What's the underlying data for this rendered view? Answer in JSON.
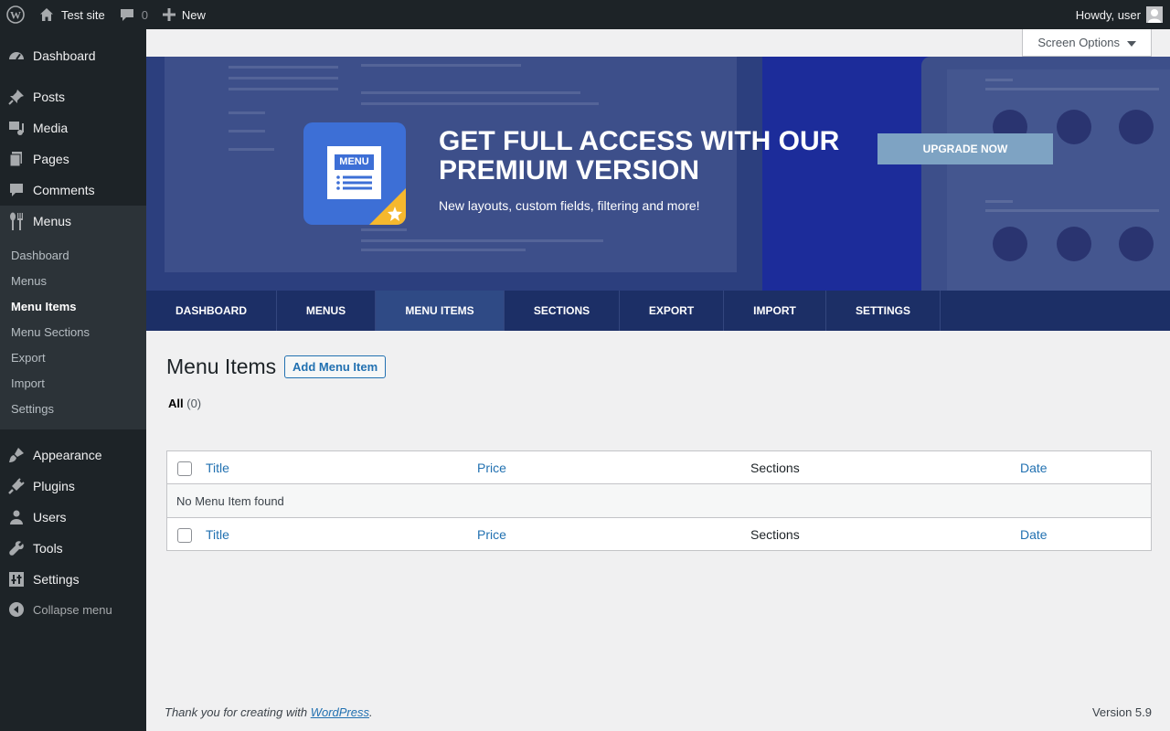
{
  "adminbar": {
    "site_name": "Test site",
    "comments_count": "0",
    "new_label": "New",
    "howdy": "Howdy, user"
  },
  "sidebar": {
    "items": [
      {
        "label": "Dashboard",
        "icon": "dashboard-icon"
      },
      {
        "label": "Posts",
        "icon": "pin-icon"
      },
      {
        "label": "Media",
        "icon": "media-icon"
      },
      {
        "label": "Pages",
        "icon": "pages-icon"
      },
      {
        "label": "Comments",
        "icon": "comment-icon"
      },
      {
        "label": "Menus",
        "icon": "fork-knife-icon"
      },
      {
        "label": "Appearance",
        "icon": "brush-icon"
      },
      {
        "label": "Plugins",
        "icon": "plug-icon"
      },
      {
        "label": "Users",
        "icon": "user-icon"
      },
      {
        "label": "Tools",
        "icon": "wrench-icon"
      },
      {
        "label": "Settings",
        "icon": "settings-icon"
      }
    ],
    "submenu": [
      "Dashboard",
      "Menus",
      "Menu Items",
      "Menu Sections",
      "Export",
      "Import",
      "Settings"
    ],
    "submenu_active": "Menu Items",
    "collapse_label": "Collapse menu"
  },
  "screen_options": "Screen Options",
  "banner": {
    "logo_text": "MENU",
    "title": "GET FULL ACCESS WITH OUR PREMIUM VERSION",
    "subtitle": "New layouts, custom fields, filtering and more!",
    "button": "UPGRADE NOW"
  },
  "tabs": [
    "DASHBOARD",
    "MENUS",
    "MENU ITEMS",
    "SECTIONS",
    "EXPORT",
    "IMPORT",
    "SETTINGS"
  ],
  "active_tab": "MENU ITEMS",
  "page": {
    "title": "Menu Items",
    "add_button": "Add Menu Item",
    "filter_all": "All",
    "filter_count": "(0)"
  },
  "table": {
    "columns": [
      "Title",
      "Price",
      "Sections",
      "Date"
    ],
    "empty_message": "No Menu Item found"
  },
  "footer": {
    "thanks_prefix": "Thank you for creating with ",
    "thanks_link": "WordPress",
    "thanks_suffix": ".",
    "version": "Version 5.9"
  },
  "colors": {
    "accent": "#2271b1",
    "sidebar_bg": "#1d2327",
    "banner_bg": "#2c3f7e",
    "tabs_bg": "#1c2f66",
    "upgrade_button": "#7ea3c3"
  }
}
